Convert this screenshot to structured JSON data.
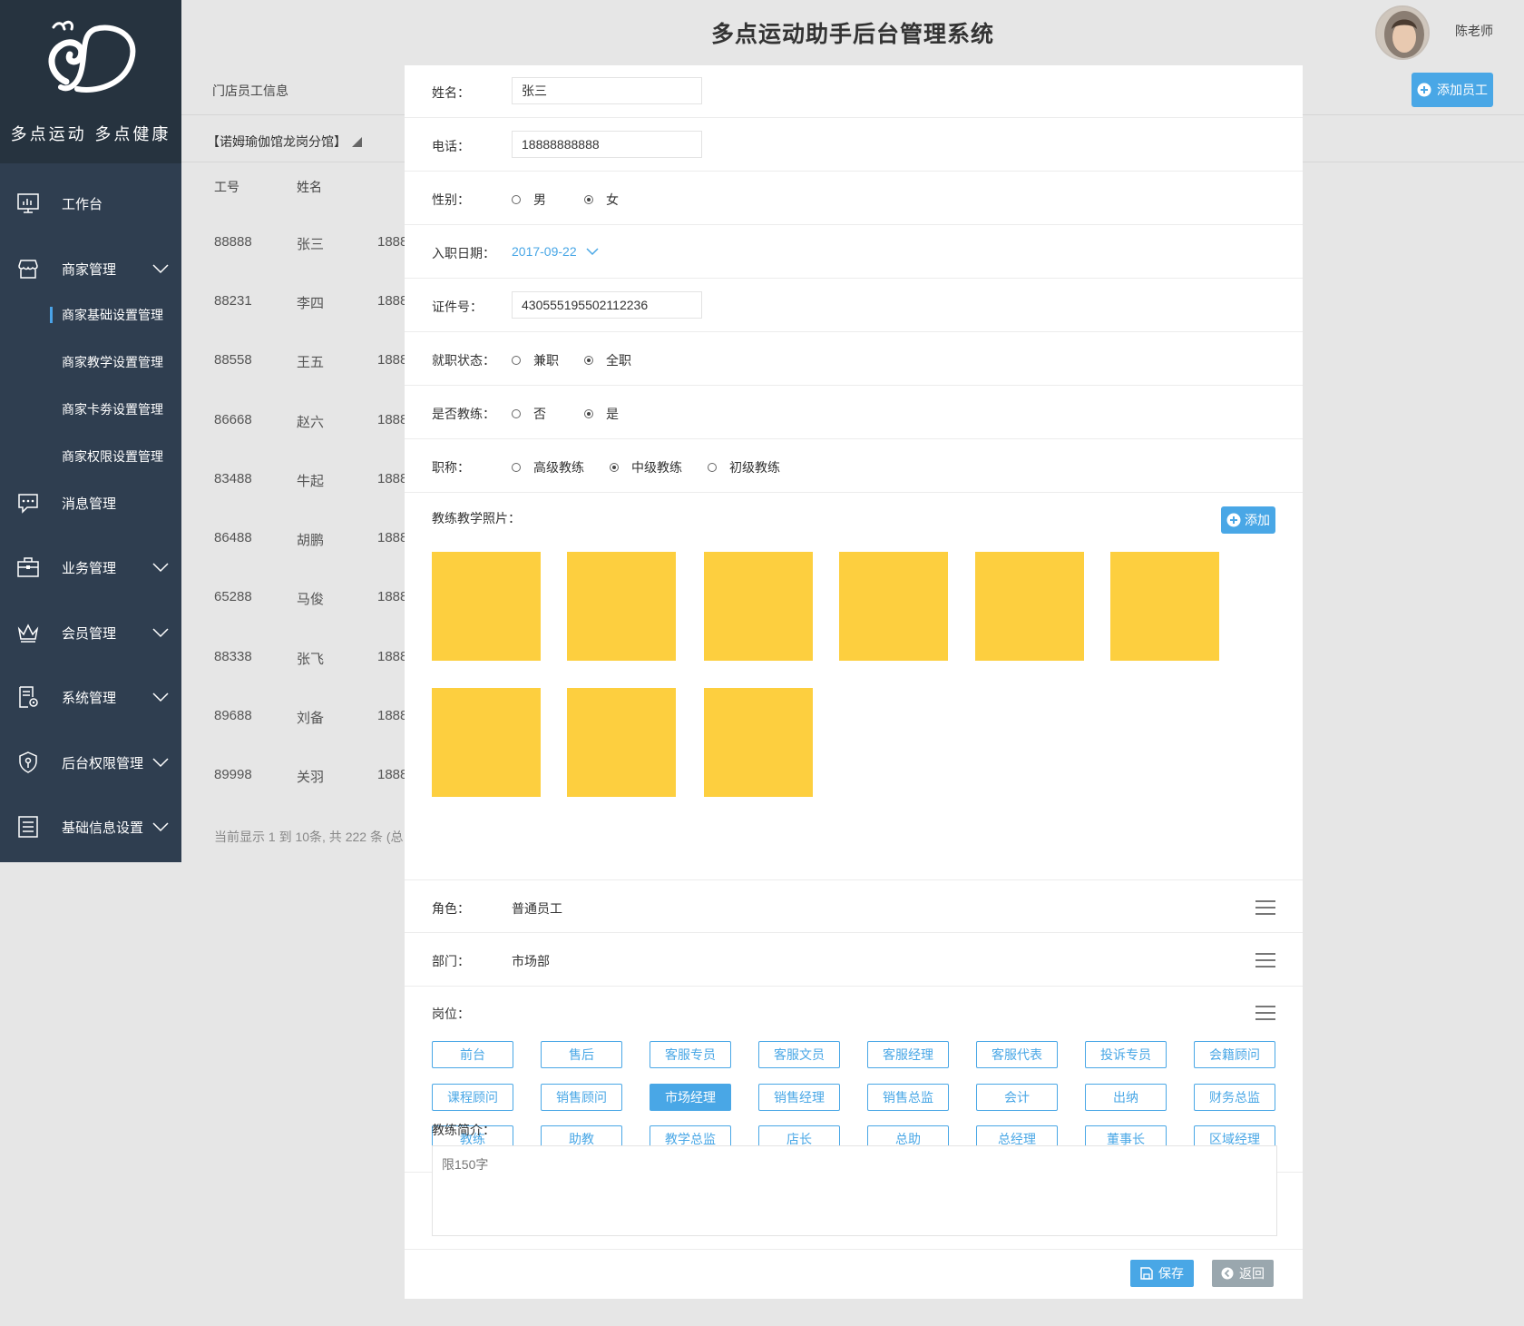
{
  "app": {
    "title": "多点运动助手后台管理系统",
    "slogan": "多点运动 多点健康",
    "user_name": "陈老师"
  },
  "colors": {
    "sidebar_bg": "#2f3e50",
    "logo_bg": "#26333f",
    "accent": "#49a7e6",
    "photo_placeholder": "#fdcf3f",
    "back_button": "#9aa7ae"
  },
  "sidebar": {
    "items": [
      {
        "label": "工作台",
        "icon": "monitor-chart-icon"
      },
      {
        "label": "商家管理",
        "icon": "store-icon",
        "expanded": true,
        "sub": [
          {
            "label": "商家基础设置管理",
            "active": true
          },
          {
            "label": "商家教学设置管理"
          },
          {
            "label": "商家卡劵设置管理"
          },
          {
            "label": "商家权限设置管理"
          }
        ]
      },
      {
        "label": "消息管理",
        "icon": "chat-bubble-icon"
      },
      {
        "label": "业务管理",
        "icon": "briefcase-icon"
      },
      {
        "label": "会员管理",
        "icon": "crown-icon"
      },
      {
        "label": "系统管理",
        "icon": "document-gear-icon"
      },
      {
        "label": "后台权限管理",
        "icon": "shield-key-icon"
      },
      {
        "label": "基础信息设置",
        "icon": "list-icon"
      }
    ]
  },
  "background": {
    "sub_header": "门店员工信息",
    "branch": "【诺姆瑜伽馆龙岗分馆】",
    "add_staff_label": "添加员工",
    "columns": [
      "工号",
      "姓名"
    ],
    "rows": [
      {
        "id": "88888",
        "name": "张三",
        "phone": "1888"
      },
      {
        "id": "88231",
        "name": "李四",
        "phone": "1888"
      },
      {
        "id": "88558",
        "name": "王五",
        "phone": "1888"
      },
      {
        "id": "86668",
        "name": "赵六",
        "phone": "1888"
      },
      {
        "id": "83488",
        "name": "牛起",
        "phone": "1888"
      },
      {
        "id": "86488",
        "name": "胡鹏",
        "phone": "1888"
      },
      {
        "id": "65288",
        "name": "马俊",
        "phone": "1888"
      },
      {
        "id": "88338",
        "name": "张飞",
        "phone": "1888"
      },
      {
        "id": "89688",
        "name": "刘备",
        "phone": "1888"
      },
      {
        "id": "89998",
        "name": "关羽",
        "phone": "1888"
      }
    ],
    "footer": "当前显示 1 到 10条, 共 222 条 (总"
  },
  "form": {
    "name": {
      "label": "姓名：",
      "value": "张三"
    },
    "phone": {
      "label": "电话：",
      "value": "18888888888"
    },
    "gender": {
      "label": "性别：",
      "options": [
        "男",
        "女"
      ],
      "selected": 1
    },
    "hire_date": {
      "label": "入职日期：",
      "value": "2017-09-22"
    },
    "id_number": {
      "label": "证件号：",
      "value": "430555195502112236"
    },
    "employment": {
      "label": "就职状态：",
      "options": [
        "兼职",
        "全职"
      ],
      "selected": 1
    },
    "is_coach": {
      "label": "是否教练：",
      "options": [
        "否",
        "是"
      ],
      "selected": 1
    },
    "title": {
      "label": "职称：",
      "options": [
        "高级教练",
        "中级教练",
        "初级教练"
      ],
      "selected": 1
    },
    "photos": {
      "label": "教练教学照片：",
      "add_label": "添加",
      "count": 9
    },
    "role": {
      "label": "角色：",
      "value": "普通员工"
    },
    "department": {
      "label": "部门：",
      "value": "市场部"
    },
    "positions": {
      "label": "岗位：",
      "tags": [
        "前台",
        "售后",
        "客服专员",
        "客服文员",
        "客服经理",
        "客服代表",
        "投诉专员",
        "会籍顾问",
        "课程顾问",
        "销售顾问",
        "市场经理",
        "销售经理",
        "销售总监",
        "会计",
        "出纳",
        "财务总监",
        "教练",
        "助教",
        "教学总监",
        "店长",
        "总助",
        "总经理",
        "董事长",
        "区域经理"
      ],
      "selected": "市场经理"
    },
    "intro": {
      "label": "教练简介：",
      "value": "限150字"
    },
    "save_label": "保存",
    "back_label": "返回"
  }
}
